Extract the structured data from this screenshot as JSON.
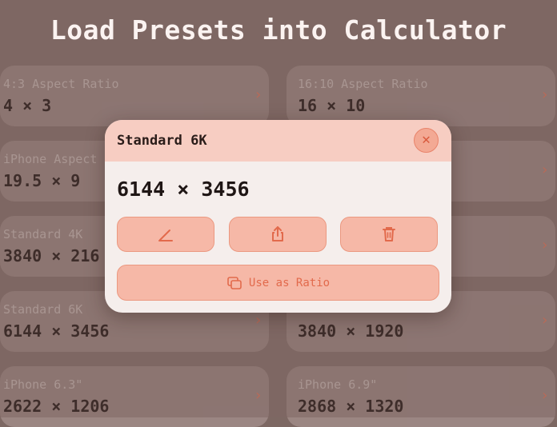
{
  "headline": "Load Presets into Calculator",
  "cards": [
    {
      "title": "4:3 Aspect Ratio",
      "value": "4 × 3"
    },
    {
      "title": "16:10 Aspect Ratio",
      "value": "16 × 10"
    },
    {
      "title": "iPhone Aspect",
      "value": "19.5 × 9"
    },
    {
      "title": "",
      "value": ""
    },
    {
      "title": "Standard 4K",
      "value": "3840 × 216"
    },
    {
      "title": "",
      "value": ""
    },
    {
      "title": "Standard 6K",
      "value": "6144 × 3456"
    },
    {
      "title": "",
      "value": "3840 × 1920"
    },
    {
      "title": "iPhone 6.3\"",
      "value": "2622 × 1206"
    },
    {
      "title": "iPhone 6.9\"",
      "value": "2868 × 1320"
    }
  ],
  "chevron": "›",
  "dialog": {
    "title": "Standard 6K",
    "close_glyph": "✕",
    "value": "6144 × 3456",
    "actions": {
      "edit_icon": "pencil-icon",
      "share_icon": "share-icon",
      "delete_icon": "trash-icon"
    },
    "ratio_label": "Use as Ratio"
  },
  "colors": {
    "accent": "#e26a4c",
    "dialog_header": "#f7cdc2",
    "button_fill": "#f6b8a7"
  }
}
